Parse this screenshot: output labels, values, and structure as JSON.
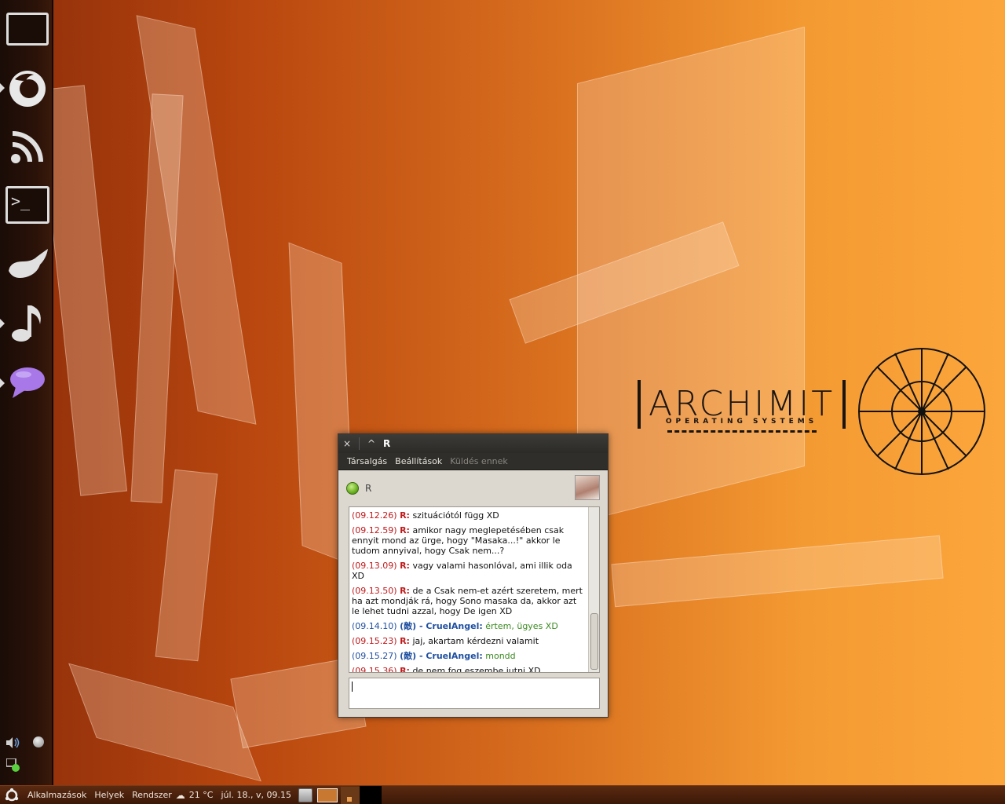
{
  "dock": {
    "items": [
      {
        "icon": "window-icon"
      },
      {
        "icon": "firefox-icon"
      },
      {
        "icon": "rss-feed-icon"
      },
      {
        "icon": "terminal-icon"
      },
      {
        "icon": "gimp-icon"
      },
      {
        "icon": "music-note-icon"
      },
      {
        "icon": "chat-bubble-icon"
      }
    ],
    "tray": [
      "volume-icon",
      "power-icon",
      "network-icon"
    ]
  },
  "wallpaper": {
    "logo_text": "ARCHIMIT",
    "logo_subtitle": "OPERATING SYSTEMS"
  },
  "chat_window": {
    "title": "R",
    "close_glyph": "×",
    "collapse_glyph": "^",
    "menu": {
      "conversation": "Társalgás",
      "settings": "Beállítások",
      "send_to": "Küldés ennek"
    },
    "contact_name": "R",
    "messages": [
      {
        "time": "(09.12.26)",
        "nick": "R:",
        "text": "szituációtól függ XD",
        "who": "r"
      },
      {
        "time": "(09.12.59)",
        "nick": "R:",
        "text": "amikor nagy meglepetésében csak ennyit mond az ürge, hogy \"Masaka...!\" akkor le tudom annyival, hogy Csak nem...?",
        "who": "r"
      },
      {
        "time": "(09.13.09)",
        "nick": "R:",
        "text": "vagy valami hasonlóval, ami illik oda XD",
        "who": "r"
      },
      {
        "time": "(09.13.50)",
        "nick": "R:",
        "text": "de a Csak nem-et azért szeretem, mert ha azt mondják rá, hogy Sono masaka da, akkor azt le lehet tudni azzal, hogy De igen XD",
        "who": "r"
      },
      {
        "time": "(09.14.10)",
        "nick": "(敵) - CruelAngel:",
        "text": "értem, ügyes XD",
        "who": "c"
      },
      {
        "time": "(09.15.23)",
        "nick": "R:",
        "text": "jaj, akartam kérdezni valamit",
        "who": "r"
      },
      {
        "time": "(09.15.27)",
        "nick": "(敵) - CruelAngel:",
        "text": "mondd",
        "who": "c"
      },
      {
        "time": "(09.15.36)",
        "nick": "R:",
        "text": "de nem fog eszembe jutni XD",
        "who": "r"
      }
    ],
    "input_value": ""
  },
  "panel": {
    "applications": "Alkalmazások",
    "places": "Helyek",
    "system": "Rendszer",
    "weather": "21 °C",
    "clock": "júl. 18., v, 09.15"
  }
}
